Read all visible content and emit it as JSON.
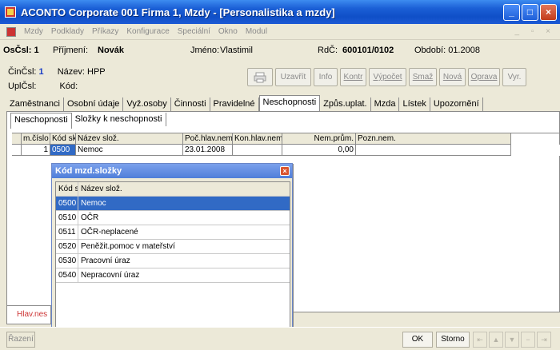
{
  "window": {
    "title": "ACONTO Corporate 001 Firma 1, Mzdy - [Personalistika a mzdy]"
  },
  "menu": [
    "Mzdy",
    "Podklady",
    "Příkazy",
    "Konfigurace",
    "Speciální",
    "Okno",
    "Modul"
  ],
  "employee": {
    "oscst_label": "OsČsl: 1",
    "prijmeni_label": "Příjmení:",
    "prijmeni": "Novák",
    "jmeno_label": "Jméno:",
    "jmeno": "Vlastimil",
    "rdc_label": "RdČ:",
    "rdc": "600101/0102",
    "obdobi": "Období: 01.2008",
    "cincst_label": "ČinČsl:",
    "cincst": "1",
    "nazev": "Název: HPP",
    "uplcst_label": "UplČsl:",
    "kod_label": "Kód:"
  },
  "toolbar": [
    "Uzavřít",
    "Info",
    "Kontr",
    "Výpočet",
    "Smaž",
    "Nová",
    "Oprava",
    "Vyr."
  ],
  "tabs_main": [
    "Zaměstnanci",
    "Osobní údaje",
    "Vyž.osoby",
    "Činnosti",
    "Pravidelné",
    "Neschopnosti",
    "Způs.uplat.",
    "Mzda",
    "Lístek",
    "Upozornění"
  ],
  "tabs_sub": [
    "Neschopnosti",
    "Složky k neschopnosti"
  ],
  "grid": {
    "headers": [
      "m.číslo",
      "Kód sk",
      "Název slož.",
      "Poč.hlav.nem",
      "Kon.hlav.nem",
      "Nem.prům.",
      "Pozn.nem."
    ],
    "row": [
      "1",
      "0500",
      "Nemoc",
      "23.01.2008",
      "",
      "0,00",
      ""
    ]
  },
  "popup": {
    "title": "Kód mzd.složky",
    "headers": [
      "Kód sk",
      "Název slož."
    ],
    "rows": [
      {
        "kod": "0500",
        "nazev": "Nemoc"
      },
      {
        "kod": "0510",
        "nazev": "OČR"
      },
      {
        "kod": "0511",
        "nazev": "OČR-neplacené"
      },
      {
        "kod": "0520",
        "nazev": "Peněžit.pomoc v mateřství"
      },
      {
        "kod": "0530",
        "nazev": "Pracovní úraz"
      },
      {
        "kod": "0540",
        "nazev": "Nepracovní úraz"
      }
    ]
  },
  "bottom": {
    "hlav": "Hlav.nes",
    "razeni": "Řazení",
    "ok": "OK",
    "storno": "Storno"
  },
  "colors": {
    "title_blue": "#1b5fd6",
    "selection": "#316ac5"
  }
}
